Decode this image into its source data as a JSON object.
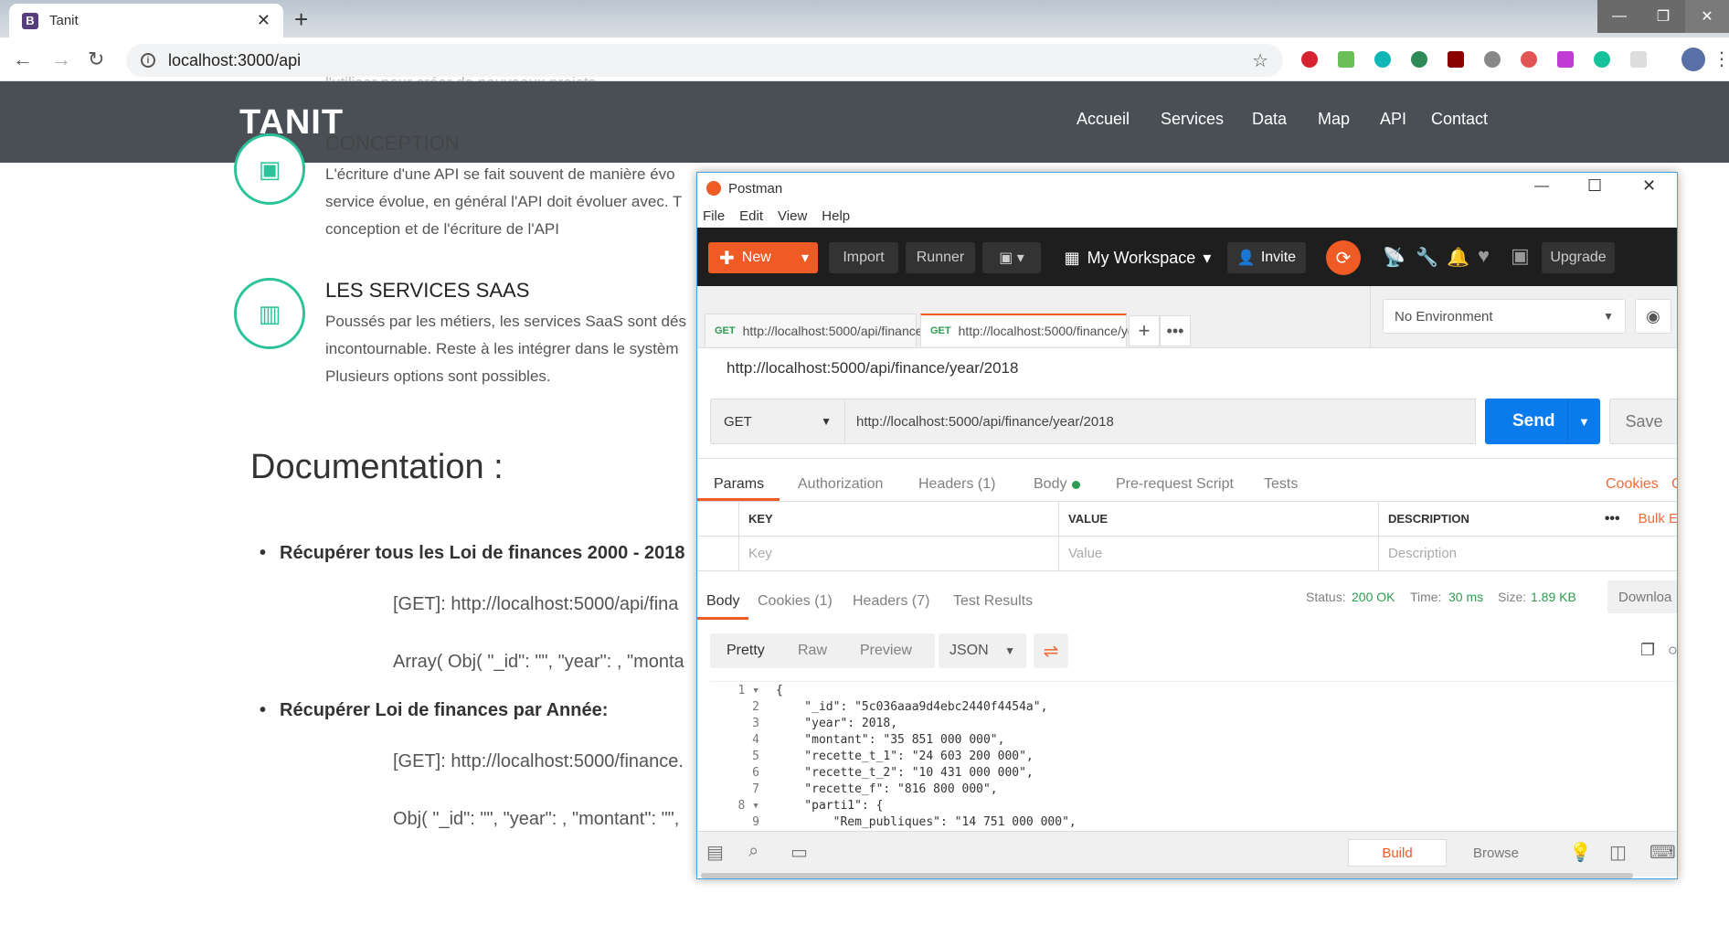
{
  "browser": {
    "tab_title": "Tanit",
    "tab_icon": "B",
    "address": "localhost:3000/api"
  },
  "site": {
    "logo": "TANIT",
    "nav": [
      "Accueil",
      "Services",
      "Data",
      "Map",
      "API",
      "Contact"
    ],
    "faded_text": "l'utiliser pour créer de nouveaux projets",
    "sections": [
      {
        "title": "CONCEPTION",
        "lines": [
          "L'écriture d'une API se fait souvent de manière évo",
          "service évolue, en général l'API doit évoluer avec. T",
          "conception et de l'écriture de l'API"
        ]
      },
      {
        "title": "LES SERVICES SAAS",
        "lines": [
          "Poussés par les métiers, les services SaaS sont dés",
          "incontournable. Reste à les intégrer dans le systèm",
          "Plusieurs options sont possibles."
        ]
      }
    ],
    "doc_title": "Documentation :",
    "items": [
      {
        "title": "Récupérer tous les Loi de finances 2000 - 2018",
        "lines": [
          "[GET]: http://localhost:5000/api/fina",
          "Array( Obj( \"_id\": \"\", \"year\": , \"monta"
        ]
      },
      {
        "title": "Récupérer Loi de finances par Année:",
        "lines": [
          "[GET]: http://localhost:5000/finance.",
          "Obj( \"_id\": \"\", \"year\": , \"montant\": \"\","
        ]
      }
    ]
  },
  "postman": {
    "title": "Postman",
    "menu": [
      "File",
      "Edit",
      "View",
      "Help"
    ],
    "header": {
      "new": "New",
      "import": "Import",
      "runner": "Runner",
      "workspace": "My Workspace",
      "invite": "Invite",
      "upgrade": "Upgrade"
    },
    "tabs": [
      {
        "method": "GET",
        "url": "http://localhost:5000/api/finance"
      },
      {
        "method": "GET",
        "url": "http://localhost:5000/finance/yea"
      }
    ],
    "environment": "No Environment",
    "request_name": "http://localhost:5000/api/finance/year/2018",
    "method": "GET",
    "url": "http://localhost:5000/api/finance/year/2018",
    "send": "Send",
    "save": "Save",
    "req_tabs": [
      "Params",
      "Authorization",
      "Headers (1)",
      "Body",
      "Pre-request Script",
      "Tests"
    ],
    "cookies_link": "Cookies",
    "code_link": "C",
    "params_headers": {
      "key": "KEY",
      "value": "VALUE",
      "description": "DESCRIPTION",
      "bulk": "Bulk E"
    },
    "params_placeholders": {
      "key": "Key",
      "value": "Value",
      "description": "Description"
    },
    "resp_tabs": [
      "Body",
      "Cookies (1)",
      "Headers (7)",
      "Test Results"
    ],
    "status": {
      "status_label": "Status:",
      "status": "200 OK",
      "time_label": "Time:",
      "time": "30 ms",
      "size_label": "Size:",
      "size": "1.89 KB",
      "download": "Downloa"
    },
    "format_buttons": [
      "Pretty",
      "Raw",
      "Preview"
    ],
    "format": "JSON",
    "code": [
      "{",
      "    \"_id\": \"5c036aaa9d4ebc2440f4454a\",",
      "    \"year\": 2018,",
      "    \"montant\": \"35 851 000 000\",",
      "    \"recette_t_1\": \"24 603 200 000\",",
      "    \"recette_t_2\": \"10 431 000 000\",",
      "    \"recette_f\": \"816 800 000\",",
      "    \"parti1\": {",
      "        \"Rem_publiques\": \"14 751 000 000\","
    ],
    "footer": {
      "build": "Build",
      "browse": "Browse"
    }
  },
  "colors": {
    "accent": "#2bc49a",
    "postman_orange": "#ef5b25",
    "send_blue": "#097bed",
    "site_header": "#4a4f56"
  }
}
